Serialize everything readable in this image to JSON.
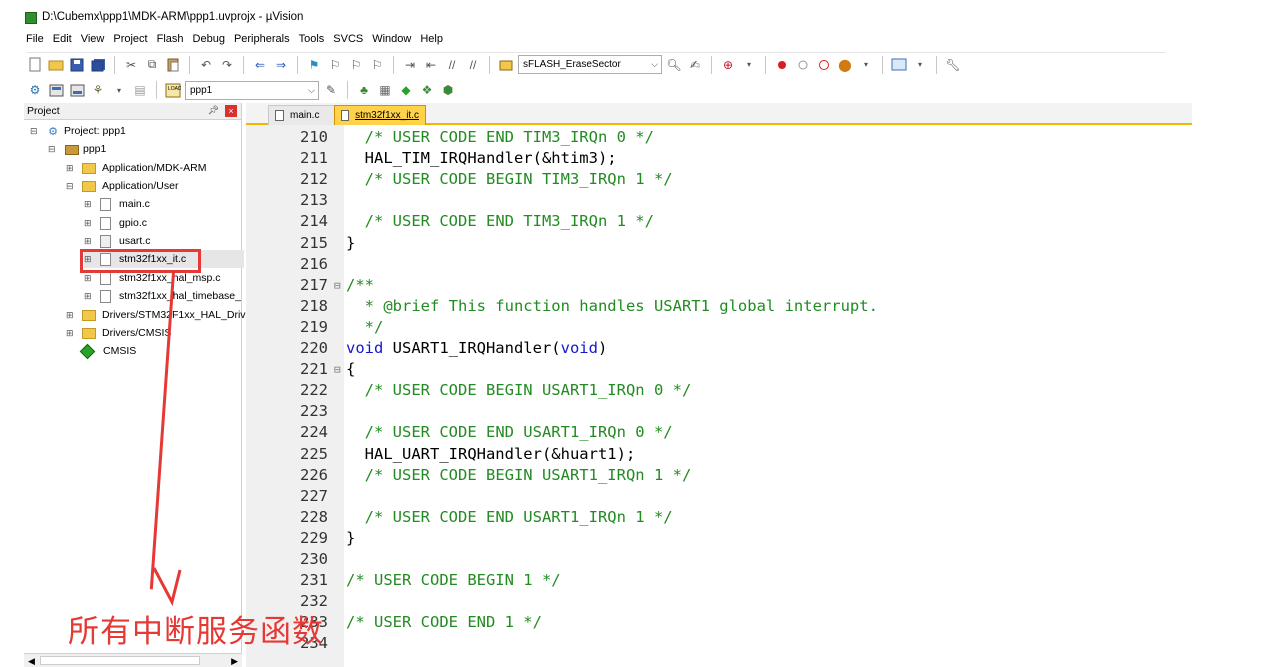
{
  "window": {
    "title": "D:\\Cubemx\\ppp1\\MDK-ARM\\ppp1.uvprojx - µVision"
  },
  "menu": [
    "File",
    "Edit",
    "View",
    "Project",
    "Flash",
    "Debug",
    "Peripherals",
    "Tools",
    "SVCS",
    "Window",
    "Help"
  ],
  "toolbar": {
    "target_combo": "sFLASH_EraseSector",
    "project_combo": "ppp1"
  },
  "project_panel": {
    "header": "Project",
    "pin_glyph": "ᵖ",
    "tree": [
      {
        "label": "Project: ppp1",
        "depth": 0,
        "type": "project",
        "expanded": true
      },
      {
        "label": "ppp1",
        "depth": 1,
        "type": "target",
        "expanded": true
      },
      {
        "label": "Application/MDK-ARM",
        "depth": 2,
        "type": "folder",
        "expanded": false
      },
      {
        "label": "Application/User",
        "depth": 2,
        "type": "folder",
        "expanded": true
      },
      {
        "label": "main.c",
        "depth": 3,
        "type": "file"
      },
      {
        "label": "gpio.c",
        "depth": 3,
        "type": "file"
      },
      {
        "label": "usart.c",
        "depth": 3,
        "type": "file"
      },
      {
        "label": "stm32f1xx_it.c",
        "depth": 3,
        "type": "file",
        "selected": true
      },
      {
        "label": "stm32f1xx_hal_msp.c",
        "depth": 3,
        "type": "file"
      },
      {
        "label": "stm32f1xx_hal_timebase_",
        "depth": 3,
        "type": "file"
      },
      {
        "label": "Drivers/STM32F1xx_HAL_Driv",
        "depth": 2,
        "type": "folder",
        "expanded": false
      },
      {
        "label": "Drivers/CMSIS",
        "depth": 2,
        "type": "folder",
        "expanded": false
      },
      {
        "label": "CMSIS",
        "depth": 2,
        "type": "cmsis"
      }
    ]
  },
  "tabs": [
    {
      "label": "main.c",
      "active": false
    },
    {
      "label": "stm32f1xx_it.c",
      "active": true
    }
  ],
  "editor": {
    "lines": [
      {
        "num": "210",
        "fold": "",
        "segments": [
          {
            "t": "  ",
            "c": ""
          },
          {
            "t": "/* USER CODE END TIM3_IRQn 0 */",
            "c": "comment"
          }
        ]
      },
      {
        "num": "211",
        "fold": "",
        "segments": [
          {
            "t": "  HAL_TIM_IRQHandler(&htim3);",
            "c": ""
          }
        ]
      },
      {
        "num": "212",
        "fold": "",
        "segments": [
          {
            "t": "  ",
            "c": ""
          },
          {
            "t": "/* USER CODE BEGIN TIM3_IRQn 1 */",
            "c": "comment"
          }
        ]
      },
      {
        "num": "213",
        "fold": "",
        "segments": []
      },
      {
        "num": "214",
        "fold": "",
        "segments": [
          {
            "t": "  ",
            "c": ""
          },
          {
            "t": "/* USER CODE END TIM3_IRQn 1 */",
            "c": "comment"
          }
        ]
      },
      {
        "num": "215",
        "fold": "",
        "segments": [
          {
            "t": "}",
            "c": ""
          }
        ]
      },
      {
        "num": "216",
        "fold": "",
        "segments": []
      },
      {
        "num": "217",
        "fold": "⊟",
        "segments": [
          {
            "t": "/**",
            "c": "comment"
          }
        ]
      },
      {
        "num": "218",
        "fold": "",
        "segments": [
          {
            "t": "  * @brief This function handles USART1 global interrupt.",
            "c": "comment"
          }
        ]
      },
      {
        "num": "219",
        "fold": "",
        "segments": [
          {
            "t": "  */",
            "c": "comment"
          }
        ]
      },
      {
        "num": "220",
        "fold": "",
        "segments": [
          {
            "t": "void",
            "c": "kw"
          },
          {
            "t": " USART1_IRQHandler(",
            "c": ""
          },
          {
            "t": "void",
            "c": "kw"
          },
          {
            "t": ")",
            "c": ""
          }
        ]
      },
      {
        "num": "221",
        "fold": "⊟",
        "segments": [
          {
            "t": "{",
            "c": ""
          }
        ]
      },
      {
        "num": "222",
        "fold": "",
        "segments": [
          {
            "t": "  ",
            "c": ""
          },
          {
            "t": "/* USER CODE BEGIN USART1_IRQn 0 */",
            "c": "comment"
          }
        ]
      },
      {
        "num": "223",
        "fold": "",
        "segments": []
      },
      {
        "num": "224",
        "fold": "",
        "segments": [
          {
            "t": "  ",
            "c": ""
          },
          {
            "t": "/* USER CODE END USART1_IRQn 0 */",
            "c": "comment"
          }
        ]
      },
      {
        "num": "225",
        "fold": "",
        "segments": [
          {
            "t": "  HAL_UART_IRQHandler(&huart1);",
            "c": ""
          }
        ]
      },
      {
        "num": "226",
        "fold": "",
        "segments": [
          {
            "t": "  ",
            "c": ""
          },
          {
            "t": "/* USER CODE BEGIN USART1_IRQn 1 */",
            "c": "comment"
          }
        ]
      },
      {
        "num": "227",
        "fold": "",
        "segments": []
      },
      {
        "num": "228",
        "fold": "",
        "segments": [
          {
            "t": "  ",
            "c": ""
          },
          {
            "t": "/* USER CODE END USART1_IRQn 1 */",
            "c": "comment"
          }
        ]
      },
      {
        "num": "229",
        "fold": "",
        "segments": [
          {
            "t": "}",
            "c": ""
          }
        ]
      },
      {
        "num": "230",
        "fold": "",
        "segments": []
      },
      {
        "num": "231",
        "fold": "",
        "segments": [
          {
            "t": "/* USER CODE BEGIN 1 */",
            "c": "comment"
          }
        ]
      },
      {
        "num": "232",
        "fold": "",
        "segments": []
      },
      {
        "num": "233",
        "fold": "",
        "segments": [
          {
            "t": "/* USER CODE END 1 */",
            "c": "comment"
          }
        ]
      },
      {
        "num": "234",
        "fold": "",
        "segments": []
      }
    ]
  },
  "annotation": {
    "text": "所有中断服务函数",
    "color": "#e53935"
  },
  "colors": {
    "comment": "#228b22",
    "keyword": "#1515d0",
    "tab_active": "#ffd24a",
    "tab_underline": "#f2b800"
  }
}
